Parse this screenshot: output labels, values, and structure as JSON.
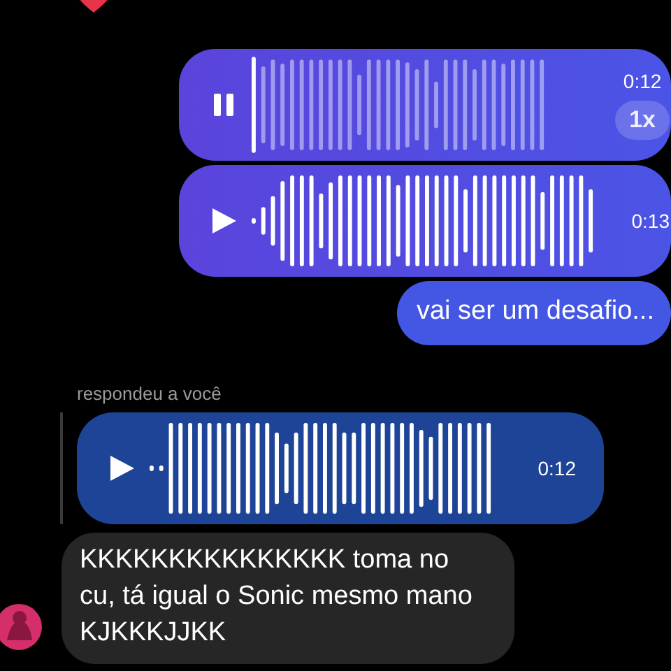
{
  "messages": [
    {
      "kind": "voice",
      "outgoing": true,
      "playing": true,
      "duration": "0:12",
      "speed": "1x"
    },
    {
      "kind": "voice",
      "outgoing": true,
      "playing": false,
      "duration": "0:13"
    },
    {
      "kind": "text",
      "outgoing": true,
      "text": "vai ser um desafio..."
    },
    {
      "kind": "voice",
      "outgoing": false,
      "reply_label": "respondeu a você",
      "playing": false,
      "duration": "0:12"
    },
    {
      "kind": "text",
      "outgoing": false,
      "avatar": true,
      "text": "KKKKKKKKKKKKKKK toma no cu, tá igual o Sonic mesmo mano KJKKKJJKK"
    }
  ]
}
